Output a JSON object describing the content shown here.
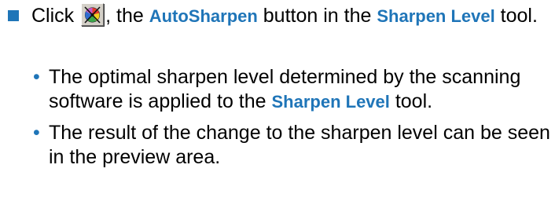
{
  "step": {
    "t1": "Click ",
    "t2": ", the ",
    "h1": "AutoSharpen",
    "t3": " button in the ",
    "h2": "Sharpen Level",
    "t4": " tool.",
    "icon": "autosharpen-icon"
  },
  "results": [
    {
      "t1": "The optimal sharpen level determined by the scanning software is applied to the ",
      "h1": "Sharpen Level",
      "t2": " tool."
    },
    {
      "t1": "The result of the change to the sharpen level can be seen in the preview area."
    }
  ],
  "colors": {
    "accent": "#1f75b8",
    "text": "#000000"
  }
}
